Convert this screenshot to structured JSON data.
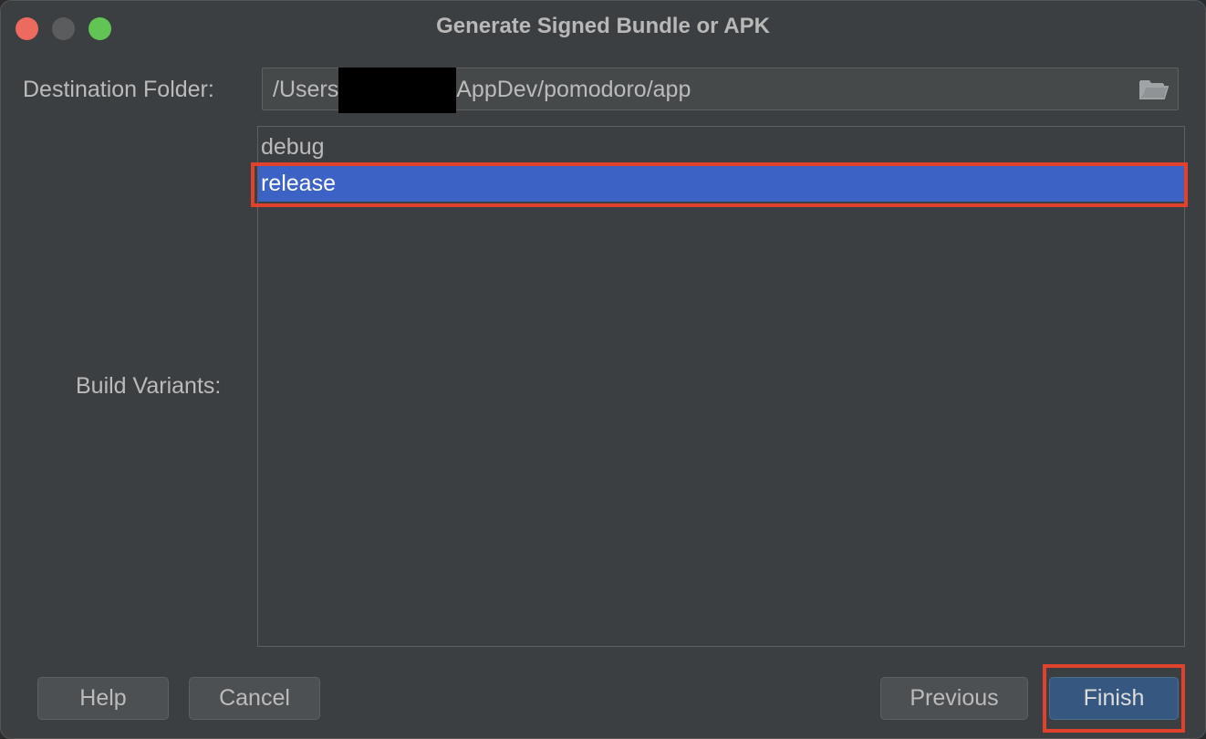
{
  "window": {
    "title": "Generate Signed Bundle or APK"
  },
  "destination": {
    "label": "Destination Folder:",
    "path_prefix": "/Users",
    "path_suffix": "AppDev/pomodoro/app",
    "browse_icon": "folder-open-icon"
  },
  "build_variants": {
    "label": "Build Variants:",
    "items": [
      {
        "label": "debug",
        "selected": false
      },
      {
        "label": "release",
        "selected": true
      }
    ]
  },
  "buttons": {
    "help": "Help",
    "cancel": "Cancel",
    "previous": "Previous",
    "finish": "Finish"
  },
  "colors": {
    "selection": "#3d62c5",
    "highlight": "#e0422d",
    "default_button": "#365880"
  }
}
